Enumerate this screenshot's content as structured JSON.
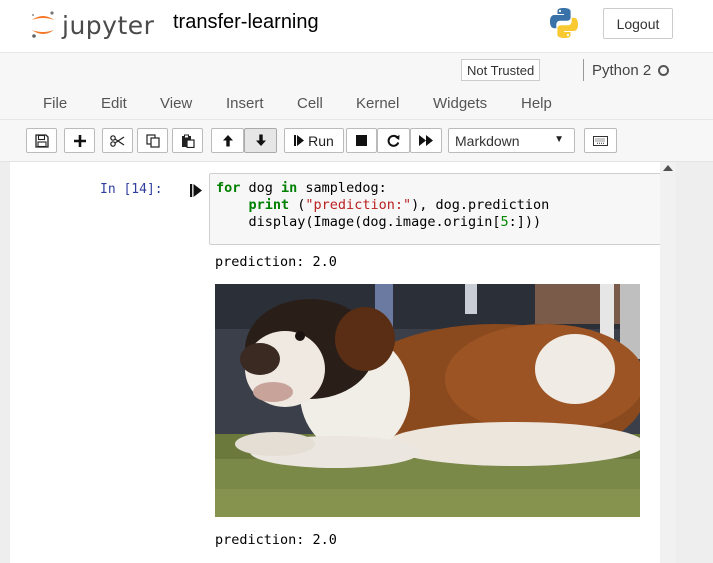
{
  "header": {
    "logo_text": "jupyter",
    "notebook_name": "transfer-learning",
    "logout_label": "Logout",
    "logo_icon": "jupyter-logo-icon",
    "kernel_logo_icon": "python-logo-icon"
  },
  "menubar": {
    "trust_label": "Not Trusted",
    "kernel_name": "Python 2",
    "items": [
      "File",
      "Edit",
      "View",
      "Insert",
      "Cell",
      "Kernel",
      "Widgets",
      "Help"
    ]
  },
  "toolbar": {
    "buttons": [
      "save-icon",
      "plus-icon",
      "cut-icon",
      "copy-icon",
      "paste-icon",
      "arrow-up-icon",
      "arrow-down-icon"
    ],
    "run_label": "Run",
    "cell_type": "Markdown"
  },
  "cell": {
    "prompt": "In [14]:",
    "code": {
      "line1_kw1": "for",
      "line1_a": " dog ",
      "line1_kw2": "in",
      "line1_b": " sampledog:",
      "line2_indent": "    ",
      "line2_kw": "print",
      "line2_a": " (",
      "line2_str": "\"prediction:\"",
      "line2_b": "), dog.prediction",
      "line3_a": "    display(Image(dog.image.origin[",
      "line3_num": "5",
      "line3_b": ":]))"
    },
    "outputs": {
      "first": "prediction: 2.0",
      "second": "prediction: 2.0",
      "image_icon": "dog-photo-icon"
    }
  },
  "colors": {
    "jupyter_orange": "#f37726",
    "prompt_blue": "#303f9f",
    "keyword_green": "#008000",
    "string_red": "#ba2121"
  }
}
